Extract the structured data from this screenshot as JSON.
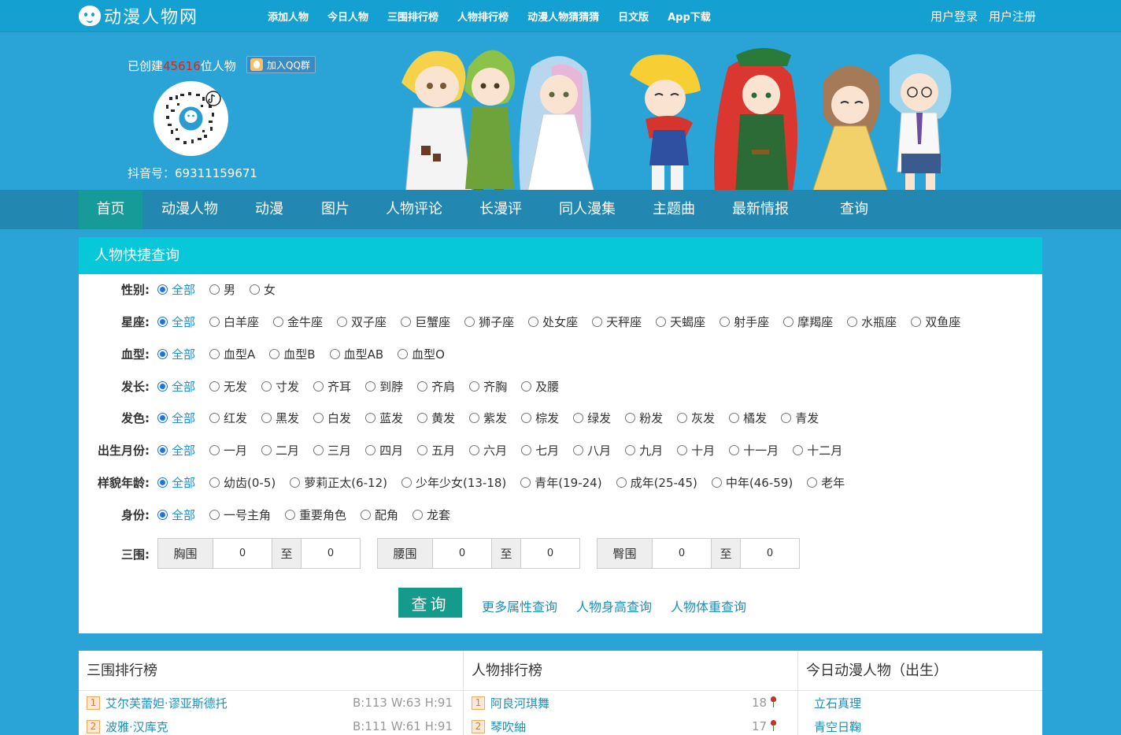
{
  "site": {
    "logo_text": "动漫人物网",
    "top_nav": [
      "添加人物",
      "今日人物",
      "三围排行榜",
      "人物排行榜",
      "动漫人物猜猜猜",
      "日文版",
      "App下载"
    ],
    "user_links": [
      "用户登录",
      "用户注册"
    ]
  },
  "banner": {
    "created_prefix": "已创建",
    "created_count": "45616",
    "created_suffix": "位人物",
    "qq_group_label": "加入QQ群",
    "douyin_label": "抖音号：69311159671"
  },
  "main_nav": [
    "首页",
    "动漫人物",
    "动漫",
    "图片",
    "人物评论",
    "长漫评",
    "同人漫集",
    "主题曲",
    "最新情报",
    "查询"
  ],
  "search": {
    "title": "人物快捷查询",
    "rows": [
      {
        "label": "性别:",
        "options": [
          "全部",
          "男",
          "女"
        ]
      },
      {
        "label": "星座:",
        "options": [
          "全部",
          "白羊座",
          "金牛座",
          "双子座",
          "巨蟹座",
          "狮子座",
          "处女座",
          "天秤座",
          "天蝎座",
          "射手座",
          "摩羯座",
          "水瓶座",
          "双鱼座"
        ]
      },
      {
        "label": "血型:",
        "options": [
          "全部",
          "血型A",
          "血型B",
          "血型AB",
          "血型O"
        ]
      },
      {
        "label": "发长:",
        "options": [
          "全部",
          "无发",
          "寸发",
          "齐耳",
          "到脖",
          "齐肩",
          "齐胸",
          "及腰"
        ]
      },
      {
        "label": "发色:",
        "options": [
          "全部",
          "红发",
          "黑发",
          "白发",
          "蓝发",
          "黄发",
          "紫发",
          "棕发",
          "绿发",
          "粉发",
          "灰发",
          "橘发",
          "青发"
        ]
      },
      {
        "label": "出生月份:",
        "options": [
          "全部",
          "一月",
          "二月",
          "三月",
          "四月",
          "五月",
          "六月",
          "七月",
          "八月",
          "九月",
          "十月",
          "十一月",
          "十二月"
        ]
      },
      {
        "label": "样貌年龄:",
        "options": [
          "全部",
          "幼齿(0-5)",
          "萝莉正太(6-12)",
          "少年少女(13-18)",
          "青年(19-24)",
          "成年(25-45)",
          "中年(46-59)",
          "老年"
        ]
      },
      {
        "label": "身份:",
        "options": [
          "全部",
          "一号主角",
          "重要角色",
          "配角",
          "龙套"
        ]
      }
    ],
    "sanwei": {
      "label": "三围:",
      "to_label": "至",
      "ranges": [
        {
          "caption": "胸围",
          "min": "0",
          "max": "0"
        },
        {
          "caption": "腰围",
          "min": "0",
          "max": "0"
        },
        {
          "caption": "臀围",
          "min": "0",
          "max": "0"
        }
      ]
    },
    "query_button": "查询",
    "links": [
      "更多属性查询",
      "人物身高查询",
      "人物体重查询"
    ]
  },
  "lists": {
    "sanwei_rank": {
      "title": "三围排行榜",
      "items": [
        {
          "rank": "1",
          "name": "艾尔芙蕾妲·谬亚斯德托",
          "stat": "B:113 W:63 H:91"
        },
        {
          "rank": "2",
          "name": "波雅·汉库克",
          "stat": "B:111 W:61 H:91"
        }
      ]
    },
    "person_rank": {
      "title": "人物排行榜",
      "items": [
        {
          "rank": "1",
          "name": "阿良河琪舞",
          "stat": "18"
        },
        {
          "rank": "2",
          "name": "琴吹紬",
          "stat": "17"
        }
      ]
    },
    "today": {
      "title": "今日动漫人物（出生）",
      "items": [
        {
          "name": "立石真理"
        },
        {
          "name": "青空日鞠"
        }
      ]
    }
  }
}
